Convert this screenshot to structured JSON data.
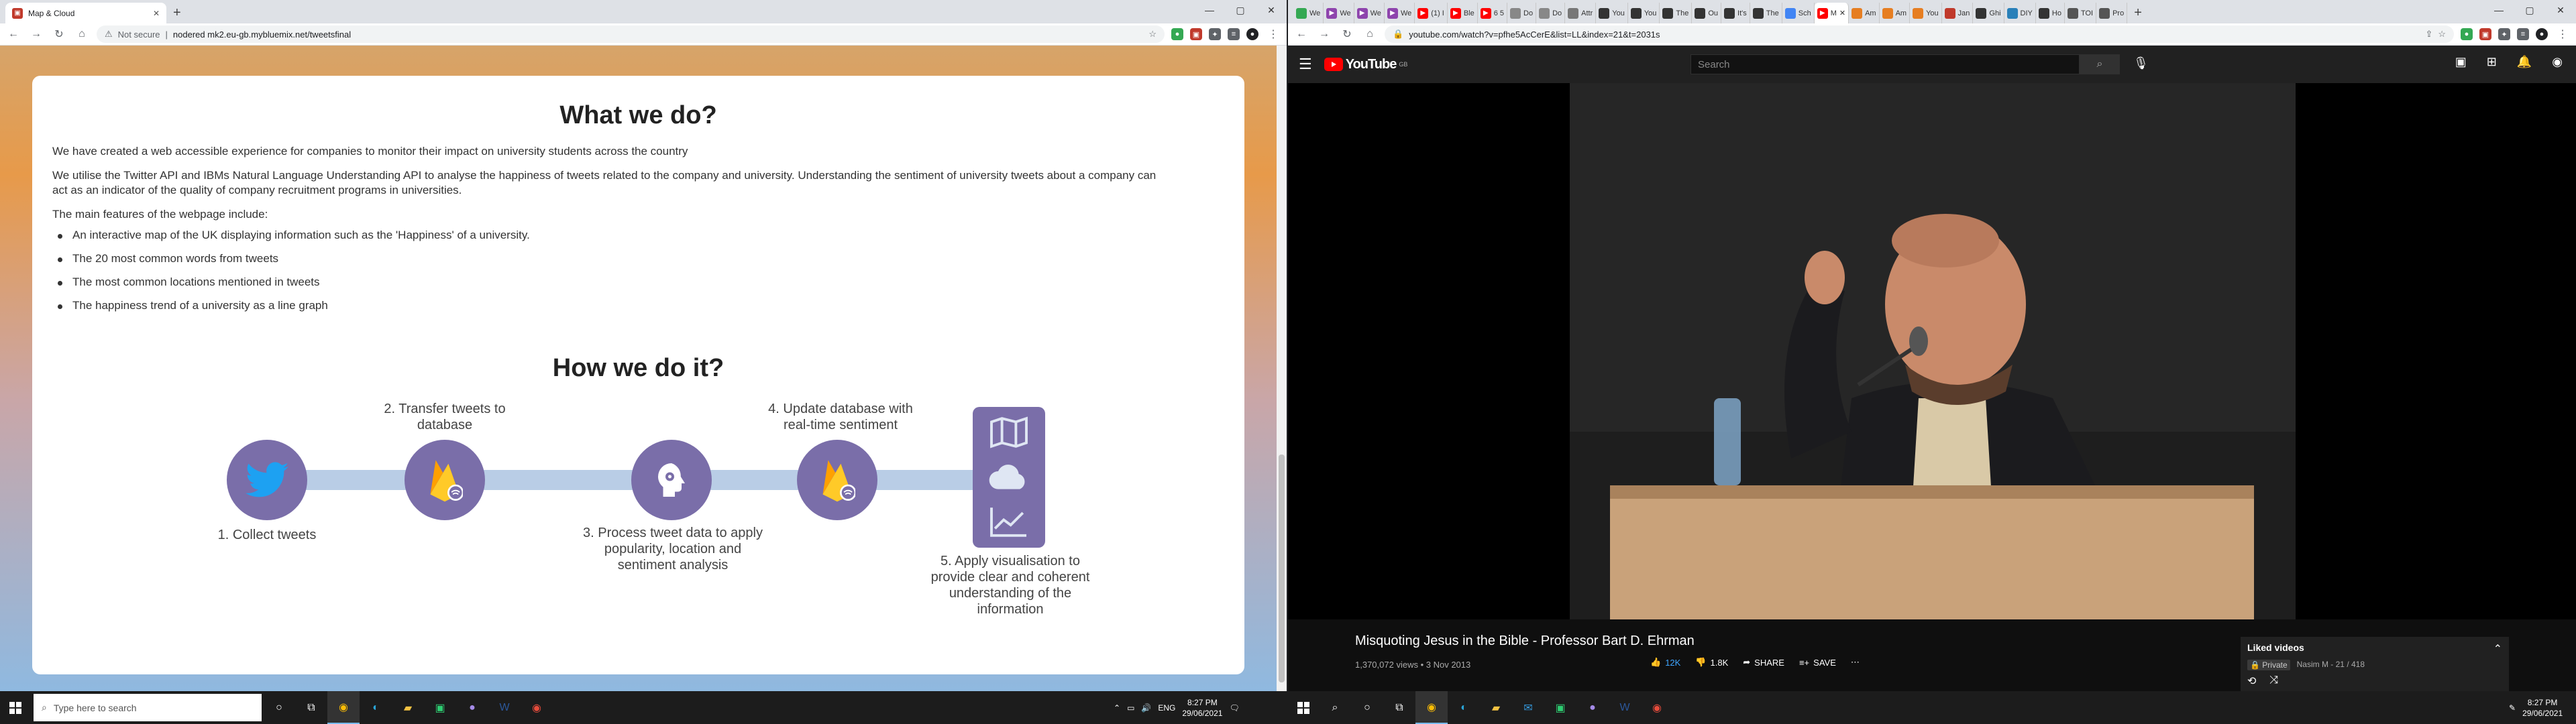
{
  "left_browser": {
    "tab_title": "Map & Cloud",
    "url": "nodered mk2.eu-gb.mybluemix.net/tweetsfinal",
    "security_text": "Not secure"
  },
  "content": {
    "what_heading": "What we do?",
    "intro_1": "We have created a web accessible experience for companies to monitor their impact on university students across the country",
    "intro_2": "We utilise the Twitter API and IBMs Natural Language Understanding API to analyse the happiness of tweets related to the company and university. Understanding the sentiment of university tweets about a company can act as an indicator of the quality of company recruitment programs in universities.",
    "features_intro": "The main features of the webpage include:",
    "features": [
      "An interactive map of the UK displaying information such as the 'Happiness' of a university.",
      "The 20 most common words from tweets",
      "The most common locations mentioned in tweets",
      "The happiness trend of a university as a line graph"
    ],
    "how_heading": "How we do it?",
    "steps": [
      "1. Collect tweets",
      "2. Transfer tweets to database",
      "3. Process tweet data to apply popularity, location and sentiment analysis",
      "4. Update database with real-time sentiment",
      "5. Apply visualisation to provide clear and coherent understanding of the information"
    ]
  },
  "right_browser": {
    "url": "youtube.com/watch?v=pfhe5AcCerE&list=LL&index=21&t=2031s",
    "tabs": [
      "We",
      "We",
      "We",
      "We",
      "(1) I",
      "Ble",
      "6 5",
      "Do",
      "Do",
      "Attr",
      "You",
      "You",
      "The",
      "Ou",
      "It's",
      "The",
      "Sch",
      "M",
      "Am",
      "Am",
      "You",
      "Jan",
      "Ghi",
      "DIY",
      "Ho",
      "TOI",
      "Pro"
    ]
  },
  "youtube": {
    "logo": "YouTube",
    "region": "GB",
    "search_placeholder": "Search",
    "video_title": "Misquoting Jesus in the Bible - Professor Bart D. Ehrman",
    "views": "1,370,072 views",
    "date": "3 Nov 2013",
    "likes": "12K",
    "dislikes": "1.8K",
    "share": "SHARE",
    "save": "SAVE",
    "playlist_title": "Liked videos",
    "playlist_privacy": "Private",
    "playlist_owner": "Nasim M - 21 / 418"
  },
  "taskbar": {
    "search_placeholder": "Type here to search",
    "lang": "ENG",
    "time": "8:27 PM",
    "date": "29/06/2021"
  },
  "colors": {
    "node_purple": "#7a6ea9",
    "bar_blue": "#b9cde6",
    "youtube_red": "#ff0000",
    "liked_blue": "#3ea6ff"
  }
}
